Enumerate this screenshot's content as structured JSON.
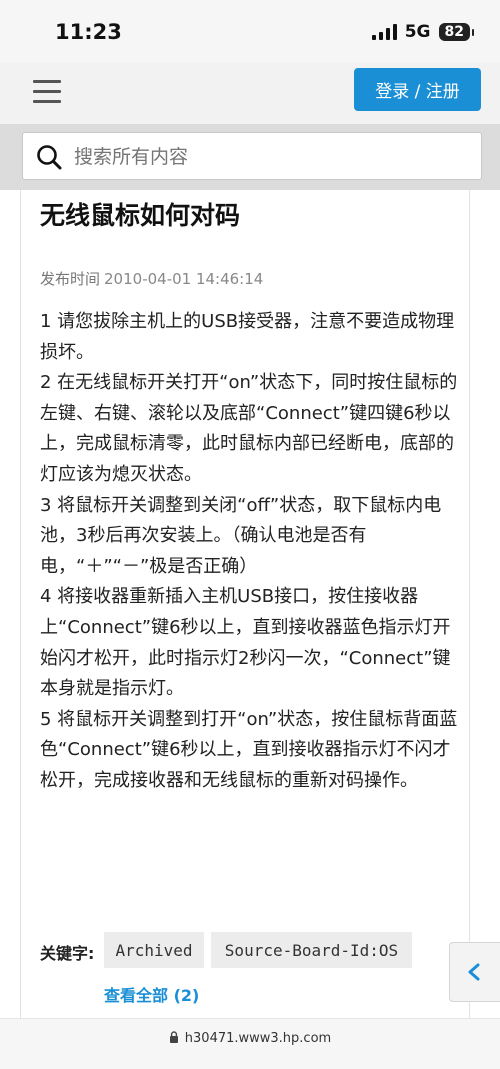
{
  "status": {
    "time": "11:23",
    "network": "5G",
    "battery": "82"
  },
  "header": {
    "login_label": "登录 / 注册"
  },
  "search": {
    "placeholder": "搜索所有内容"
  },
  "article": {
    "title": "无线鼠标如何对码",
    "publish_label": "发布时间",
    "publish_time": "2010-04-01 14:46:14",
    "paragraphs": [
      "1 请您拔除主机上的USB接受器，注意不要造成物理损坏。",
      "2 在无线鼠标开关打开“on”状态下，同时按住鼠标的左键、右键、滚轮以及底部“Connect”键四键6秒以上，完成鼠标清零，此时鼠标内部已经断电，底部的灯应该为熄灭状态。",
      "3 将鼠标开关调整到关闭“off”状态，取下鼠标内电池，3秒后再次安装上。（确认电池是否有电，“＋”“－”极是否正确）",
      "4 将接收器重新插入主机USB接口，按住接收器上“Connect”键6秒以上，直到接收器蓝色指示灯开始闪才松开，此时指示灯2秒闪一次，“Connect”键本身就是指示灯。",
      "5 将鼠标开关调整到打开“on”状态，按住鼠标背面蓝色“Connect”键6秒以上，直到接收器指示灯不闪才松开，完成接收器和无线鼠标的重新对码操作。"
    ],
    "keywords_label": "关键字:",
    "tags": [
      "Archived",
      "Source-Board-Id:OS"
    ],
    "view_all": "查看全部 (2)"
  },
  "browser": {
    "url": "h30471.www3.hp.com"
  },
  "colors": {
    "accent": "#1a8fd6"
  }
}
